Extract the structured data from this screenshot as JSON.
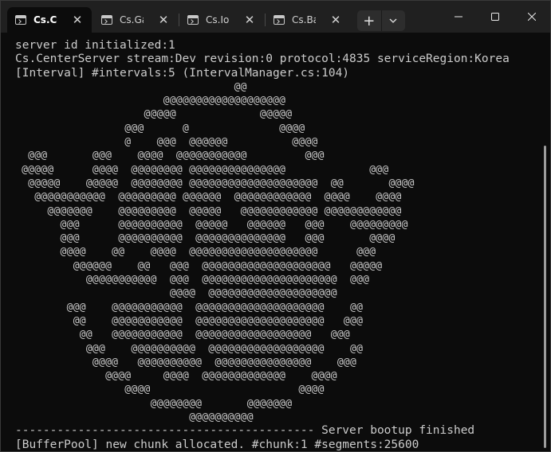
{
  "tabs": [
    {
      "title": "Cs.CenterServer",
      "active": true,
      "icon": "terminal-icon"
    },
    {
      "title": "Cs.GameServer",
      "active": false,
      "icon": "terminal-icon"
    },
    {
      "title": "Cs.IoServer",
      "active": false,
      "icon": "terminal-icon"
    },
    {
      "title": "Cs.BattleServer",
      "active": false,
      "icon": "terminal-icon"
    }
  ],
  "tab_close_glyph": "✕",
  "new_tab_glyph": "+",
  "dropdown_glyph": "⌄",
  "caption": {
    "minimize": "minimize-icon",
    "maximize": "maximize-icon",
    "close": "close-icon"
  },
  "colors": {
    "text": "#cccccc",
    "background": "#0c0c0c",
    "titlebar": "#202020"
  },
  "terminal": {
    "lines_top": [
      "server id initialized:1",
      "Cs.CenterServer stream:Dev revision:0 protocol:4835 serviceRegion:Korea",
      "[Interval] #intervals:5 (IntervalManager.cs:104)"
    ],
    "art": [
      "                                  @@",
      "                       @@@@@@@@@@@@@@@@@@@",
      "                    @@@@@             @@@@@",
      "                 @@@      @              @@@@",
      "                 @    @@@  @@@@@@          @@@@",
      "  @@@       @@@    @@@@  @@@@@@@@@@@         @@@",
      " @@@@@      @@@@  @@@@@@@@ @@@@@@@@@@@@@@@             @@@",
      "  @@@@@    @@@@@  @@@@@@@@ @@@@@@@@@@@@@@@@@@@@  @@       @@@@",
      "   @@@@@@@@@@@  @@@@@@@@@ @@@@@@  @@@@@@@@@@@@  @@@@    @@@@",
      "     @@@@@@@    @@@@@@@@@  @@@@@   @@@@@@@@@@@@ @@@@@@@@@@@@",
      "       @@@      @@@@@@@@@@  @@@@@   @@@@@@   @@@    @@@@@@@@@",
      "       @@@      @@@@@@@@@@  @@@@@@@@@@@@@@   @@@       @@@@",
      "       @@@@    @@    @@@@  @@@@@@@@@@@@@@@@@@@@      @@@",
      "         @@@@@@    @@   @@@  @@@@@@@@@@@@@@@@@@@@   @@@@@",
      "           @@@@@@@@@@@  @@@  @@@@@@@@@@@@@@@@@@@@@  @@@",
      "                        @@@@  @@@@@@@@@@@@@@@@@@@@",
      "        @@@    @@@@@@@@@@@  @@@@@@@@@@@@@@@@@@@@    @@",
      "         @@    @@@@@@@@@@@  @@@@@@@@@@@@@@@@@@@@   @@@",
      "          @@   @@@@@@@@@@@  @@@@@@@@@@@@@@@@@@   @@@",
      "           @@@    @@@@@@@@@@  @@@@@@@@@@@@@@@@@@    @@",
      "            @@@@   @@@@@@@@@@  @@@@@@@@@@@@@@@    @@@",
      "              @@@@     @@@@  @@@@@@@@@@@@@    @@@@",
      "                 @@@@                       @@@@",
      "                     @@@@@@@@       @@@@@@@",
      "                           @@@@@@@@@@"
    ],
    "lines_bottom": [
      "------------------------------------------- Server bootup finished",
      "[BufferPool] new chunk allocated. #chunk:1 #segments:25600"
    ]
  }
}
